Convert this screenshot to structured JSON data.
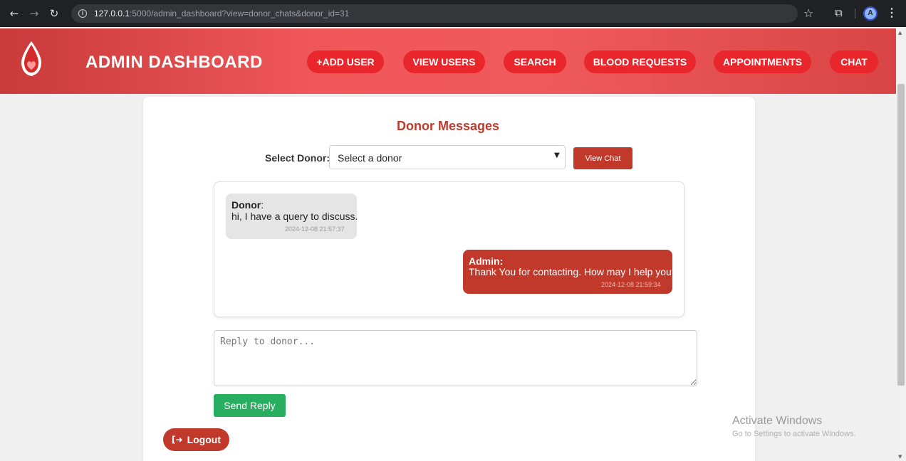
{
  "browser": {
    "url_host": "127.0.0.1",
    "url_path": ":5000/admin_dashboard?view=donor_chats&donor_id=31",
    "avatar_letter": "A"
  },
  "header": {
    "brand": "ADMIN DASHBOARD",
    "nav": [
      {
        "label": "+ADD USER"
      },
      {
        "label": "VIEW USERS"
      },
      {
        "label": "SEARCH"
      },
      {
        "label": "BLOOD REQUESTS"
      },
      {
        "label": "APPOINTMENTS"
      },
      {
        "label": "CHAT"
      }
    ]
  },
  "main": {
    "title": "Donor Messages",
    "select_label": "Select Donor:",
    "select_value": "Select a donor",
    "view_chat_label": "View Chat",
    "messages": [
      {
        "sender": "Donor",
        "text": "hi, I have a query to discuss.",
        "time": "2024-12-08 21:57:37"
      },
      {
        "sender": "Admin",
        "text": "Thank You for contacting. How may I help you?",
        "time": "2024-12-08 21:59:34"
      }
    ],
    "reply_placeholder": "Reply to donor...",
    "send_label": "Send Reply",
    "logout_label": "Logout"
  },
  "watermark": {
    "title": "Activate Windows",
    "subtitle": "Go to Settings to activate Windows."
  },
  "colors": {
    "accent": "#c0392b",
    "nav_pill": "#e8262b",
    "send": "#27ae60"
  }
}
